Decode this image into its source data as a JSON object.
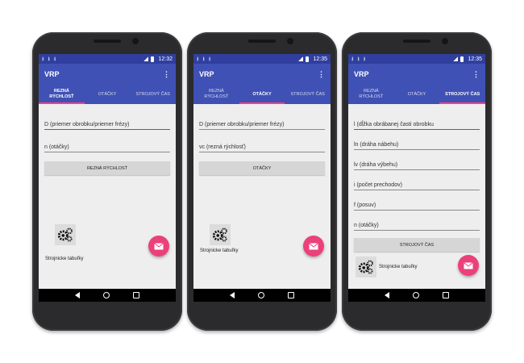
{
  "phones": [
    {
      "status": {
        "time": "12:32"
      },
      "app_title": "VRP",
      "tabs": [
        "REZNÁ\nRÝCHLOSŤ",
        "OTÁČKY",
        "STROJOVÝ ČAS"
      ],
      "active_tab": 0,
      "fields": [
        "D (priemer obrobku/priemer frézy)",
        "n (otáčky)"
      ],
      "button": "REZNÁ RÝCHLOSŤ",
      "tables_label": "Strojnicke tabuľky"
    },
    {
      "status": {
        "time": "12:35"
      },
      "app_title": "VRP",
      "tabs": [
        "REZNÁ\nRÝCHLOSŤ",
        "OTÁČKY",
        "STROJOVÝ ČAS"
      ],
      "active_tab": 1,
      "fields": [
        "D (priemer obrobku/priemer frézy)",
        "vc (rezná rýchlosť)"
      ],
      "button": "OTÁČKY",
      "tables_label": "Strojnicke tabuľky"
    },
    {
      "status": {
        "time": "12:35"
      },
      "app_title": "VRP",
      "tabs": [
        "REZNÁ\nRÝCHLOSŤ",
        "OTÁČKY",
        "STROJOVÝ ČAS"
      ],
      "active_tab": 2,
      "fields": [
        "l (dĺžka obrábanej časti obrobku",
        "ln (dráha nábehu)",
        "lv (dráha výbehu)",
        "i (počet prechodov)",
        "f (posuv)",
        "n (otáčky)"
      ],
      "button": "STROJOVÝ ČAS",
      "tables_label": "Strojnicke tabuľky"
    }
  ],
  "colors": {
    "primary": "#3f51b5",
    "primary_dark": "#303f9f",
    "accent": "#ff4081",
    "fab": "#ec407a"
  },
  "icons": {
    "fab": "email-icon",
    "tables": "gears-icon"
  }
}
